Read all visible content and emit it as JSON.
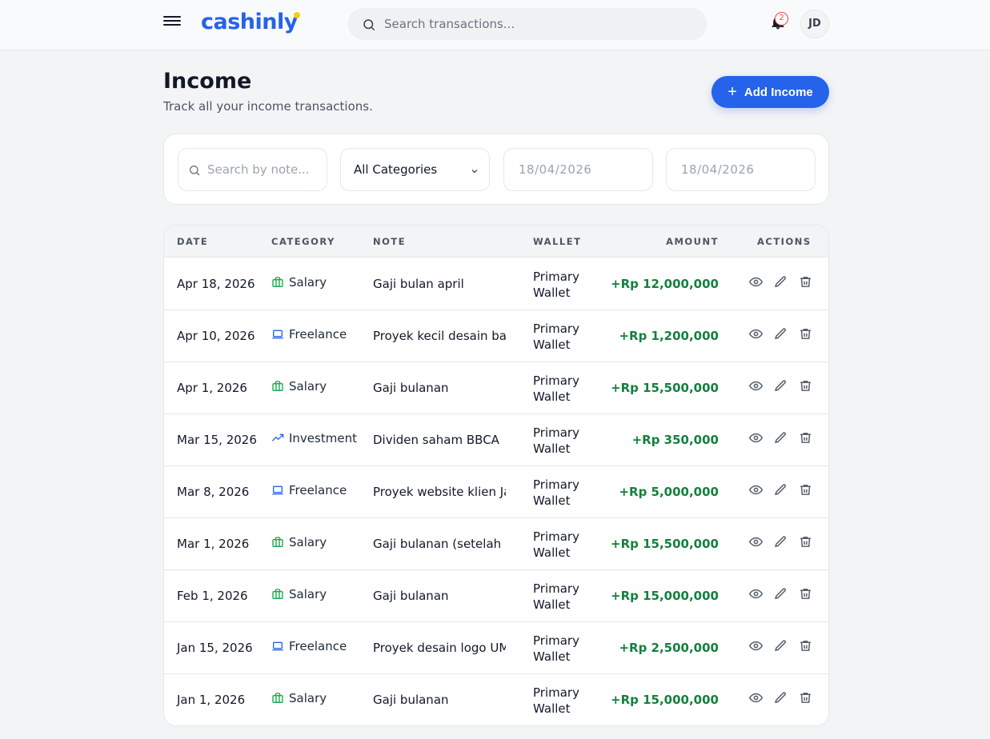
{
  "header": {
    "logo_text": "cashinly",
    "search_placeholder": "Search transactions...",
    "notification_count": "2",
    "avatar_initials": "JD"
  },
  "page": {
    "title": "Income",
    "subtitle": "Track all your income transactions.",
    "add_button_label": "Add Income"
  },
  "filters": {
    "note_search_placeholder": "Search by note...",
    "category_selected": "All Categories",
    "date_from": "18/04/2026",
    "date_to": "18/04/2026"
  },
  "table": {
    "columns": [
      "DATE",
      "CATEGORY",
      "NOTE",
      "WALLET",
      "AMOUNT",
      "ACTIONS"
    ],
    "rows": [
      {
        "date": "Apr 18, 2026",
        "category": "Salary",
        "icon": "salary-icon",
        "note": "Gaji bulan april",
        "wallet": "Primary Wallet",
        "amount": "+Rp 12,000,000"
      },
      {
        "date": "Apr 10, 2026",
        "category": "Freelance",
        "icon": "laptop-icon",
        "note": "Proyek kecil desain banner",
        "wallet": "Primary Wallet",
        "amount": "+Rp 1,200,000"
      },
      {
        "date": "Apr 1, 2026",
        "category": "Salary",
        "icon": "salary-icon",
        "note": "Gaji bulanan",
        "wallet": "Primary Wallet",
        "amount": "+Rp 15,500,000"
      },
      {
        "date": "Mar 15, 2026",
        "category": "Investment",
        "icon": "trend-up-icon",
        "note": "Dividen saham BBCA",
        "wallet": "Primary Wallet",
        "amount": "+Rp 350,000"
      },
      {
        "date": "Mar 8, 2026",
        "category": "Freelance",
        "icon": "laptop-icon",
        "note": "Proyek website klien Jakarta",
        "wallet": "Primary Wallet",
        "amount": "+Rp 5,000,000"
      },
      {
        "date": "Mar 1, 2026",
        "category": "Salary",
        "icon": "salary-icon",
        "note": "Gaji bulanan (setelah kenaikan)",
        "wallet": "Primary Wallet",
        "amount": "+Rp 15,500,000"
      },
      {
        "date": "Feb 1, 2026",
        "category": "Salary",
        "icon": "salary-icon",
        "note": "Gaji bulanan",
        "wallet": "Primary Wallet",
        "amount": "+Rp 15,000,000"
      },
      {
        "date": "Jan 15, 2026",
        "category": "Freelance",
        "icon": "laptop-icon",
        "note": "Proyek desain logo UMKM",
        "wallet": "Primary Wallet",
        "amount": "+Rp 2,500,000"
      },
      {
        "date": "Jan 1, 2026",
        "category": "Salary",
        "icon": "salary-icon",
        "note": "Gaji bulanan",
        "wallet": "Primary Wallet",
        "amount": "+Rp 15,000,000"
      }
    ]
  },
  "colors": {
    "accent": "#2563eb",
    "amount_positive": "#15803d",
    "salary_icon": "#16a34a",
    "freelance_icon": "#2563eb",
    "investment_icon": "#2563eb"
  }
}
